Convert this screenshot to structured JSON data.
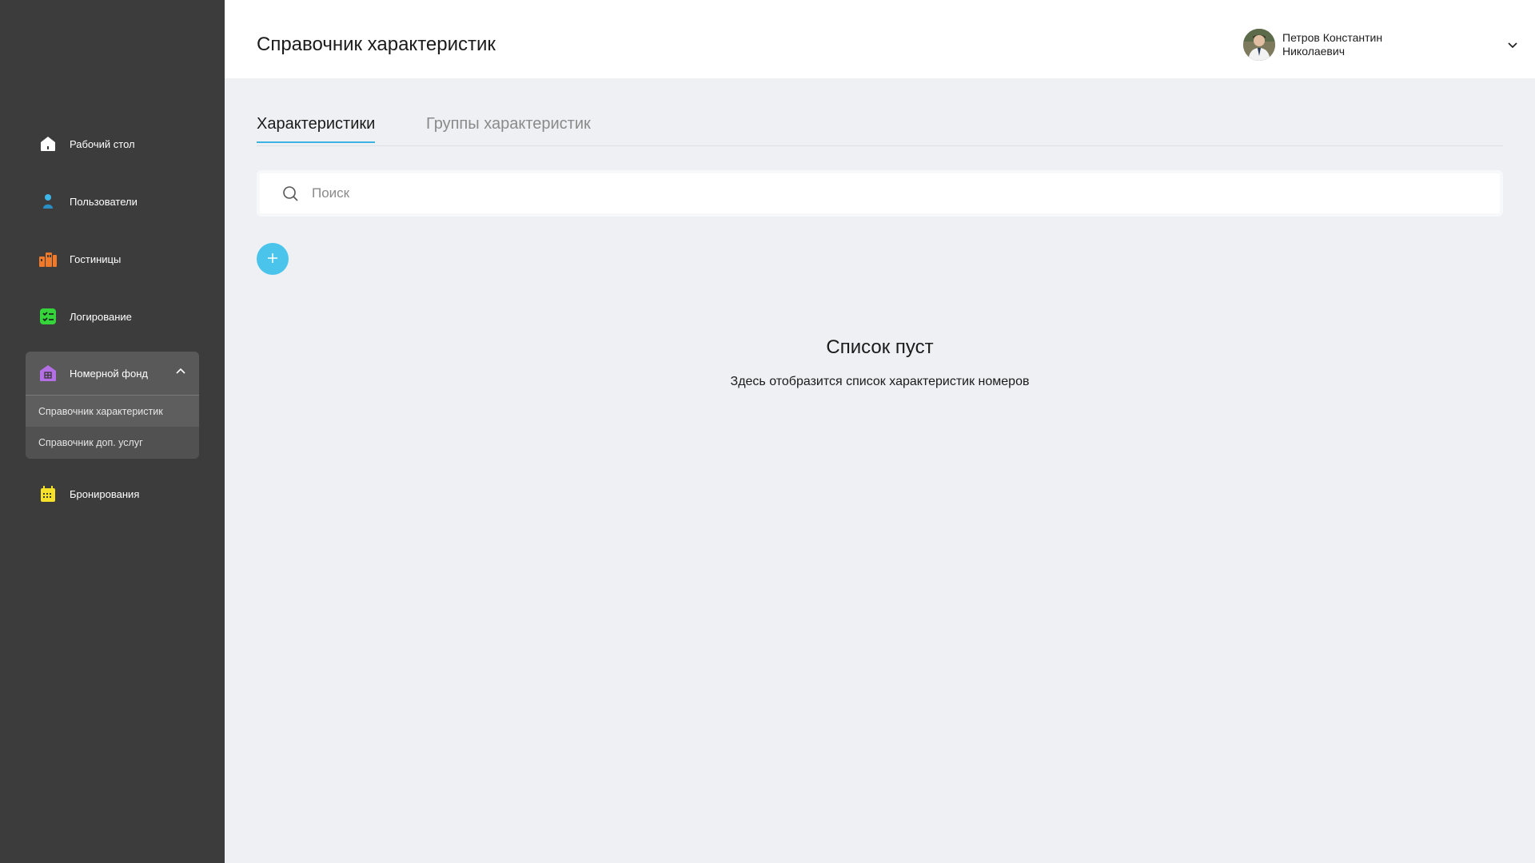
{
  "sidebar": {
    "items": [
      {
        "label": "Рабочий стол",
        "icon": "home-icon"
      },
      {
        "label": "Пользователи",
        "icon": "user-icon"
      },
      {
        "label": "Гостиницы",
        "icon": "buildings-icon"
      },
      {
        "label": "Логирование",
        "icon": "checklist-icon"
      },
      {
        "label": "Бронирования",
        "icon": "calendar-icon"
      }
    ],
    "group": {
      "label": "Номерной фонд",
      "icon": "room-stock-icon",
      "expanded": true,
      "sub_items": [
        {
          "label": "Справочник характеристик",
          "active": true
        },
        {
          "label": "Справочник доп. услуг",
          "active": false
        }
      ]
    }
  },
  "header": {
    "title": "Справочник характеристик",
    "user_name": "Петров Константин Николаевич"
  },
  "tabs": [
    {
      "label": "Характеристики",
      "active": true
    },
    {
      "label": "Группы характеристик",
      "active": false
    }
  ],
  "search": {
    "placeholder": "Поиск",
    "value": ""
  },
  "empty_state": {
    "title": "Список пуст",
    "text": "Здесь отобразится список характеристик номеров"
  },
  "colors": {
    "sidebar_bg": "#3c3c3c",
    "accent": "#4bc4ec",
    "home": "#ffffff",
    "users": "#3fb6e8",
    "hotels": "#f07a2a",
    "logging": "#34d43a",
    "room_stock": "#b46ee6",
    "bookings": "#f5e12a"
  }
}
